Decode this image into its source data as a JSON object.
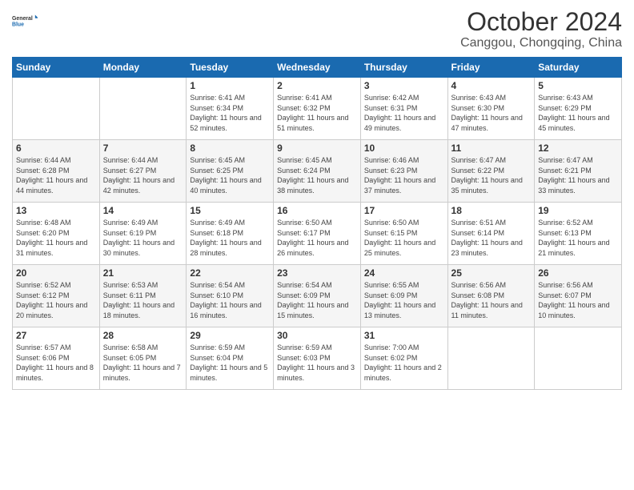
{
  "logo": {
    "line1": "General",
    "line2": "Blue"
  },
  "title": "October 2024",
  "location": "Canggou, Chongqing, China",
  "weekdays": [
    "Sunday",
    "Monday",
    "Tuesday",
    "Wednesday",
    "Thursday",
    "Friday",
    "Saturday"
  ],
  "weeks": [
    [
      null,
      null,
      {
        "day": "1",
        "sunrise": "6:41 AM",
        "sunset": "6:34 PM",
        "daylight": "11 hours and 52 minutes."
      },
      {
        "day": "2",
        "sunrise": "6:41 AM",
        "sunset": "6:32 PM",
        "daylight": "11 hours and 51 minutes."
      },
      {
        "day": "3",
        "sunrise": "6:42 AM",
        "sunset": "6:31 PM",
        "daylight": "11 hours and 49 minutes."
      },
      {
        "day": "4",
        "sunrise": "6:43 AM",
        "sunset": "6:30 PM",
        "daylight": "11 hours and 47 minutes."
      },
      {
        "day": "5",
        "sunrise": "6:43 AM",
        "sunset": "6:29 PM",
        "daylight": "11 hours and 45 minutes."
      }
    ],
    [
      {
        "day": "6",
        "sunrise": "6:44 AM",
        "sunset": "6:28 PM",
        "daylight": "11 hours and 44 minutes."
      },
      {
        "day": "7",
        "sunrise": "6:44 AM",
        "sunset": "6:27 PM",
        "daylight": "11 hours and 42 minutes."
      },
      {
        "day": "8",
        "sunrise": "6:45 AM",
        "sunset": "6:25 PM",
        "daylight": "11 hours and 40 minutes."
      },
      {
        "day": "9",
        "sunrise": "6:45 AM",
        "sunset": "6:24 PM",
        "daylight": "11 hours and 38 minutes."
      },
      {
        "day": "10",
        "sunrise": "6:46 AM",
        "sunset": "6:23 PM",
        "daylight": "11 hours and 37 minutes."
      },
      {
        "day": "11",
        "sunrise": "6:47 AM",
        "sunset": "6:22 PM",
        "daylight": "11 hours and 35 minutes."
      },
      {
        "day": "12",
        "sunrise": "6:47 AM",
        "sunset": "6:21 PM",
        "daylight": "11 hours and 33 minutes."
      }
    ],
    [
      {
        "day": "13",
        "sunrise": "6:48 AM",
        "sunset": "6:20 PM",
        "daylight": "11 hours and 31 minutes."
      },
      {
        "day": "14",
        "sunrise": "6:49 AM",
        "sunset": "6:19 PM",
        "daylight": "11 hours and 30 minutes."
      },
      {
        "day": "15",
        "sunrise": "6:49 AM",
        "sunset": "6:18 PM",
        "daylight": "11 hours and 28 minutes."
      },
      {
        "day": "16",
        "sunrise": "6:50 AM",
        "sunset": "6:17 PM",
        "daylight": "11 hours and 26 minutes."
      },
      {
        "day": "17",
        "sunrise": "6:50 AM",
        "sunset": "6:15 PM",
        "daylight": "11 hours and 25 minutes."
      },
      {
        "day": "18",
        "sunrise": "6:51 AM",
        "sunset": "6:14 PM",
        "daylight": "11 hours and 23 minutes."
      },
      {
        "day": "19",
        "sunrise": "6:52 AM",
        "sunset": "6:13 PM",
        "daylight": "11 hours and 21 minutes."
      }
    ],
    [
      {
        "day": "20",
        "sunrise": "6:52 AM",
        "sunset": "6:12 PM",
        "daylight": "11 hours and 20 minutes."
      },
      {
        "day": "21",
        "sunrise": "6:53 AM",
        "sunset": "6:11 PM",
        "daylight": "11 hours and 18 minutes."
      },
      {
        "day": "22",
        "sunrise": "6:54 AM",
        "sunset": "6:10 PM",
        "daylight": "11 hours and 16 minutes."
      },
      {
        "day": "23",
        "sunrise": "6:54 AM",
        "sunset": "6:09 PM",
        "daylight": "11 hours and 15 minutes."
      },
      {
        "day": "24",
        "sunrise": "6:55 AM",
        "sunset": "6:09 PM",
        "daylight": "11 hours and 13 minutes."
      },
      {
        "day": "25",
        "sunrise": "6:56 AM",
        "sunset": "6:08 PM",
        "daylight": "11 hours and 11 minutes."
      },
      {
        "day": "26",
        "sunrise": "6:56 AM",
        "sunset": "6:07 PM",
        "daylight": "11 hours and 10 minutes."
      }
    ],
    [
      {
        "day": "27",
        "sunrise": "6:57 AM",
        "sunset": "6:06 PM",
        "daylight": "11 hours and 8 minutes."
      },
      {
        "day": "28",
        "sunrise": "6:58 AM",
        "sunset": "6:05 PM",
        "daylight": "11 hours and 7 minutes."
      },
      {
        "day": "29",
        "sunrise": "6:59 AM",
        "sunset": "6:04 PM",
        "daylight": "11 hours and 5 minutes."
      },
      {
        "day": "30",
        "sunrise": "6:59 AM",
        "sunset": "6:03 PM",
        "daylight": "11 hours and 3 minutes."
      },
      {
        "day": "31",
        "sunrise": "7:00 AM",
        "sunset": "6:02 PM",
        "daylight": "11 hours and 2 minutes."
      },
      null,
      null
    ]
  ]
}
